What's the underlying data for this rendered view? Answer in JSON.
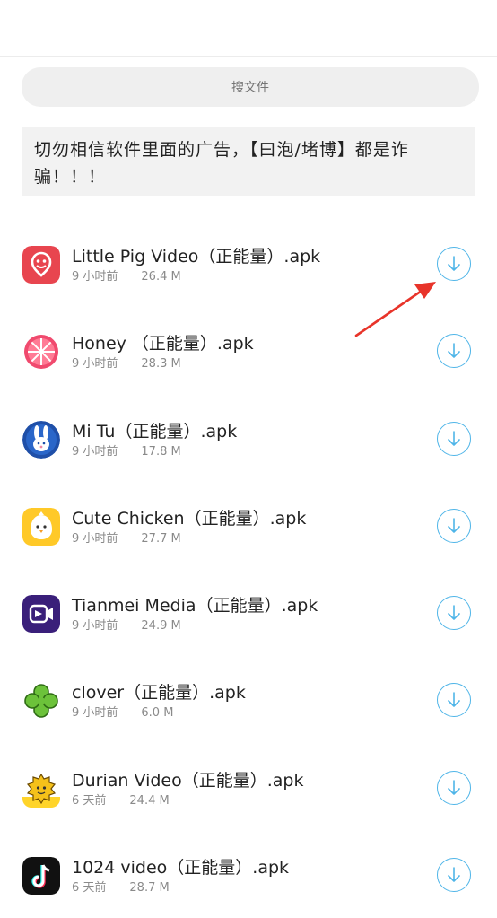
{
  "search": {
    "placeholder": "搜文件"
  },
  "notice": {
    "text": "切勿相信软件里面的广告，【曰泡/堵博】都是诈骗！！！"
  },
  "files": [
    {
      "name": "Little Pig Video（正能量）.apk",
      "time": "9 小时前",
      "size": "26.4 M",
      "icon": "pig-video-icon"
    },
    {
      "name": "Honey （正能量）.apk",
      "time": "9 小时前",
      "size": "28.3 M",
      "icon": "grapefruit-icon"
    },
    {
      "name": "Mi Tu（正能量）.apk",
      "time": "9 小时前",
      "size": "17.8 M",
      "icon": "rabbit-icon"
    },
    {
      "name": "Cute Chicken（正能量）.apk",
      "time": "9 小时前",
      "size": "27.7 M",
      "icon": "chick-icon"
    },
    {
      "name": "Tianmei Media（正能量）.apk",
      "time": "9 小时前",
      "size": "24.9 M",
      "icon": "video-camera-icon"
    },
    {
      "name": "clover（正能量）.apk",
      "time": "9 小时前",
      "size": "6.0 M",
      "icon": "clover-icon"
    },
    {
      "name": "Durian Video（正能量）.apk",
      "time": "6 天前",
      "size": "24.4 M",
      "icon": "durian-icon"
    },
    {
      "name": "1024 video（正能量）.apk",
      "time": "6 天前",
      "size": "28.7 M",
      "icon": "music-note-icon"
    }
  ],
  "colors": {
    "accent": "#4fb5e8",
    "annotation_arrow": "#e8342a"
  }
}
